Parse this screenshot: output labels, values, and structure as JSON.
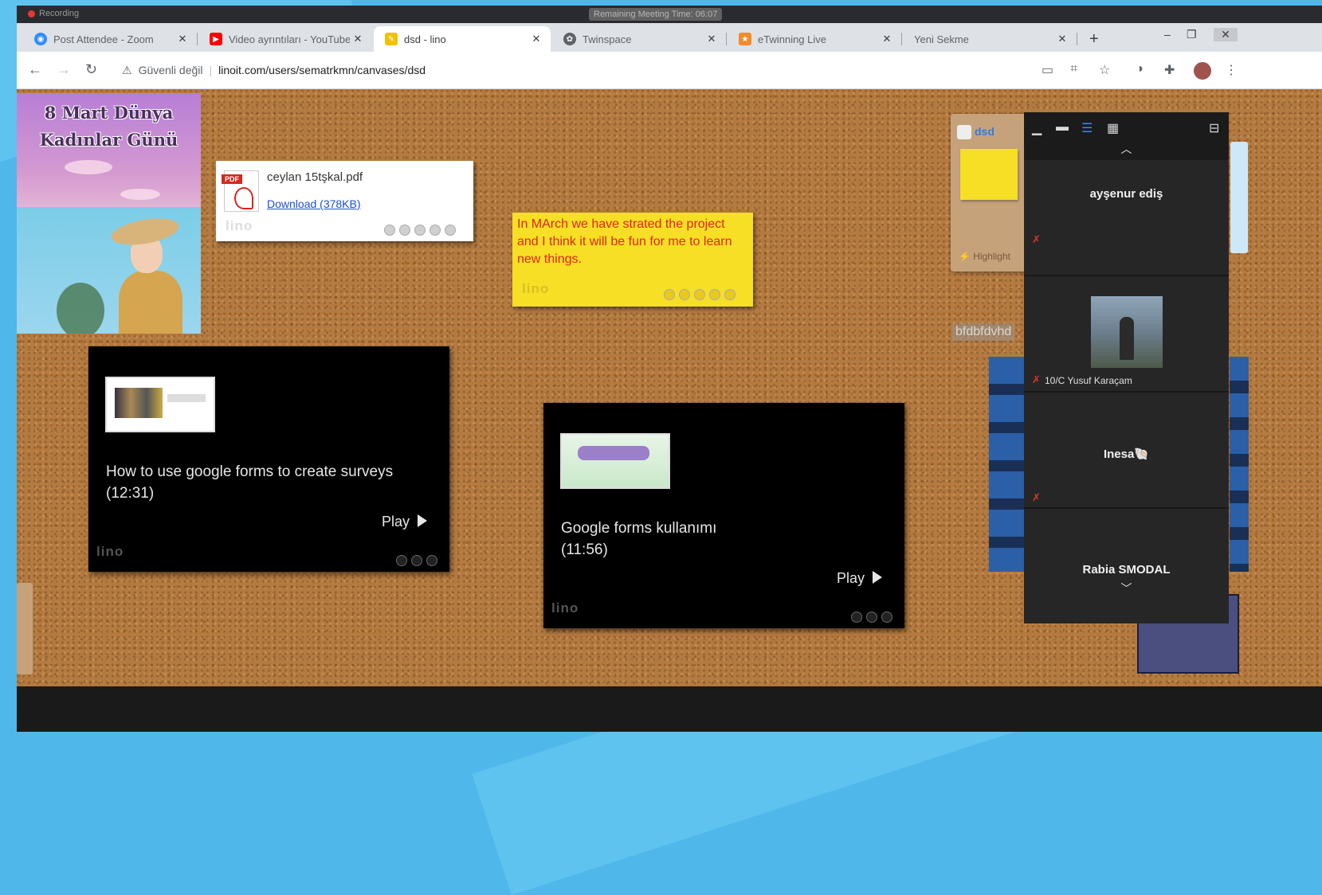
{
  "recording_banner": {
    "label": "Recording",
    "meeting_time": "Remaining Meeting Time: 06:07"
  },
  "tabs": [
    {
      "label": "Post Attendee - Zoom",
      "icon": "zoom-icon",
      "color": "#2d8cff",
      "active": false
    },
    {
      "label": "Video ayrıntıları - YouTube",
      "icon": "youtube-icon",
      "color": "#ff0000",
      "active": false
    },
    {
      "label": "dsd - lino",
      "icon": "lino-icon",
      "color": "#f2c200",
      "active": true
    },
    {
      "label": "Twinspace",
      "icon": "twinspace-icon",
      "color": "#5f6368",
      "active": false
    },
    {
      "label": "eTwinning Live",
      "icon": "etwinning-icon",
      "color": "#f28c28",
      "active": false
    },
    {
      "label": "Yeni Sekme",
      "icon": "",
      "color": "",
      "active": false
    }
  ],
  "toolbar": {
    "insecure_label": "Güvenli değil",
    "url": "linoit.com/users/sematrkmn/canvases/dsd"
  },
  "poster": {
    "title_line1": "8 Mart Dünya",
    "title_line2": "Kadınlar Günü"
  },
  "pdf_note": {
    "filename": "ceylan 15tşkal.pdf",
    "download": "Download (378KB)"
  },
  "yellow_note": {
    "text": "In MArch we have strated the project and I think it will be fun for me to learn new things."
  },
  "video1": {
    "title": "How to use google forms to create surveys",
    "duration": "(12:31)",
    "play": "Play"
  },
  "video2": {
    "title": "Google forms kullanımı",
    "duration": "(11:56)",
    "play": "Play"
  },
  "canvas_card": {
    "name": "dsd",
    "highlight": "Highlight"
  },
  "side_text": "bfdbfdvhd",
  "logo_text": "lino",
  "participants": [
    {
      "name": "ayşenur ediş",
      "label": "",
      "has_video": false
    },
    {
      "name": "",
      "label": "10/C Yusuf Karaçam",
      "has_video": true
    },
    {
      "name": "Inesa🐚",
      "label": "",
      "has_video": false
    },
    {
      "name": "Rabia SMODAL",
      "label": "",
      "has_video": false
    }
  ]
}
